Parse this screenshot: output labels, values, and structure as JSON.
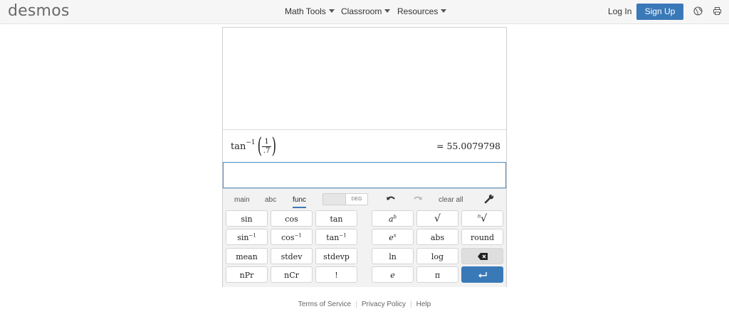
{
  "header": {
    "logo": "desmos",
    "nav": [
      {
        "label": "Math Tools"
      },
      {
        "label": "Classroom"
      },
      {
        "label": "Resources"
      }
    ],
    "login_label": "Log In",
    "signup_label": "Sign Up",
    "icons": [
      "globe-icon",
      "printer-icon"
    ],
    "accent_color": "#3a79b8"
  },
  "calculator": {
    "expression": {
      "func": "tan",
      "sup": "−1",
      "numerator": "1",
      "denominator": ".7"
    },
    "result": "= 55.0079798",
    "input_value": "",
    "tabs": [
      {
        "label": "main"
      },
      {
        "label": "abc"
      },
      {
        "label": "func",
        "active": true
      }
    ],
    "angle_mode": "DEG",
    "clear_all_label": "clear all",
    "keys_left": [
      [
        "sin",
        "cos",
        "tan"
      ],
      [
        "sin",
        "cos",
        "tan"
      ],
      [
        "mean",
        "stdev",
        "stdevp"
      ],
      [
        "nPr",
        "nCr",
        "!"
      ]
    ],
    "inverse_sup": "−1",
    "keys_right": {
      "power_base": "a",
      "power_exp": "b",
      "sqrt": "√",
      "nthroot_index": "n",
      "nthroot_radical": "√",
      "exp_base": "e",
      "exp_exp": "x",
      "abs": "abs",
      "round": "round",
      "ln": "ln",
      "log": "log",
      "e": "e",
      "pi": "π"
    }
  },
  "footer": {
    "links": [
      {
        "label": "Terms of Service"
      },
      {
        "label": "Privacy Policy"
      },
      {
        "label": "Help"
      }
    ]
  }
}
